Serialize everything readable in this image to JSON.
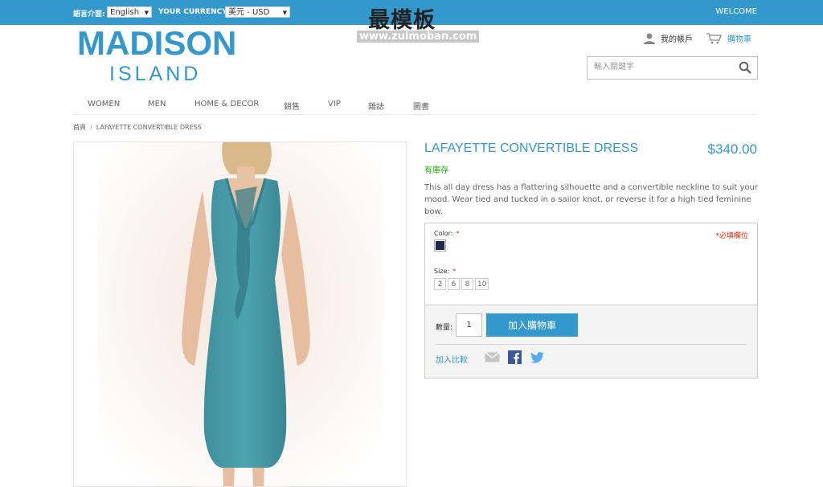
{
  "topbar": {
    "language_label": "語言介面:",
    "language_value": "English",
    "currency_label": "YOUR CURRENCY:",
    "currency_value": "美元 - USD",
    "welcome": "WELCOME"
  },
  "watermark": {
    "main": "最模板",
    "sub": "www.zuimoban.com"
  },
  "logo": {
    "line1": "MADISON",
    "line2": "ISLAND"
  },
  "header": {
    "account_label": "我的帳戶",
    "cart_label": "購物車",
    "search_placeholder": "輸入關鍵字"
  },
  "nav": {
    "items": [
      "WOMEN",
      "MEN",
      "HOME & DECOR",
      "銷售",
      "VIP",
      "雜誌",
      "圖書"
    ]
  },
  "breadcrumb": {
    "home": "首頁",
    "separator": "/",
    "current": "LAFAYETTE CONVERTIBLE DRESS"
  },
  "product": {
    "name": "LAFAYETTE CONVERTIBLE DRESS",
    "price": "$340.00",
    "stock": "有庫存",
    "description": "This all day dress has a flattering silhouette and a convertible neckline to suit your mood. Wear tied and tucked in a sailor knot, or reverse it for a high tied feminine bow.",
    "image_icon": "dress-photo"
  },
  "options": {
    "color_label": "Color:",
    "required_star": "*",
    "required_note": "*必填欄位",
    "color_swatch": "#1f2a4d",
    "size_label": "Size:",
    "sizes": [
      "2",
      "6",
      "8",
      "10"
    ]
  },
  "cart_box": {
    "qty_label": "數量:",
    "qty_value": "1",
    "add_button": "加入購物車",
    "compare_label": "加入比較",
    "share_icons": [
      "email-icon",
      "facebook-icon",
      "twitter-icon"
    ]
  },
  "colors": {
    "brand": "#3399cc",
    "stock": "#11b400",
    "required": "#df280a"
  }
}
